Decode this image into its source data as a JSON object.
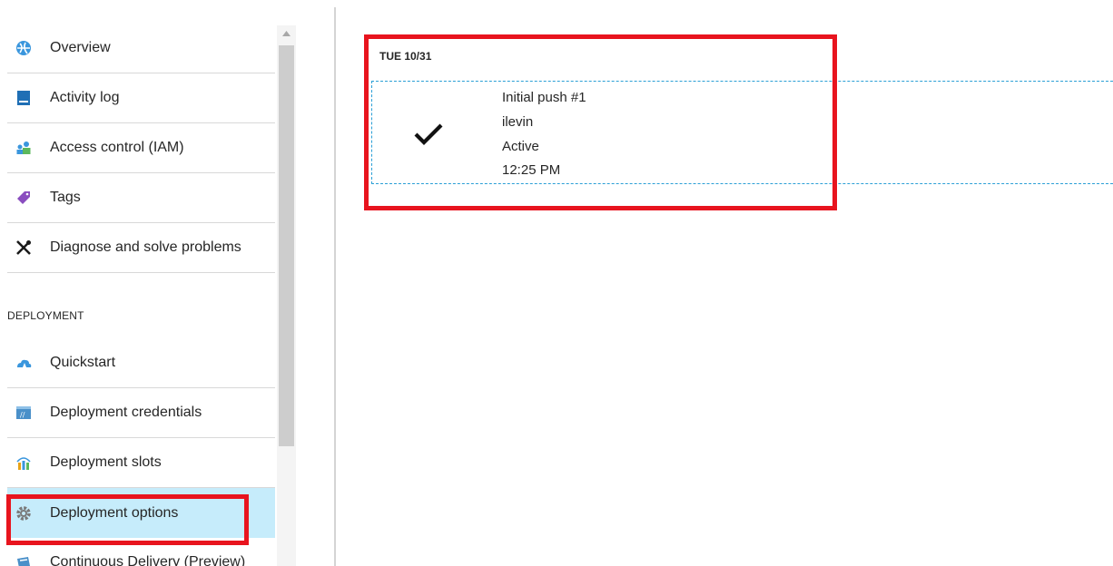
{
  "sidebar": {
    "items": [
      {
        "label": "Overview",
        "icon": "globe-icon"
      },
      {
        "label": "Activity log",
        "icon": "activity-log-icon"
      },
      {
        "label": "Access control (IAM)",
        "icon": "users-icon"
      },
      {
        "label": "Tags",
        "icon": "tag-icon"
      },
      {
        "label": "Diagnose and solve problems",
        "icon": "tools-icon"
      }
    ],
    "section_header": "DEPLOYMENT",
    "deployment_items": [
      {
        "label": "Quickstart",
        "icon": "cloud-icon"
      },
      {
        "label": "Deployment credentials",
        "icon": "credentials-icon"
      },
      {
        "label": "Deployment slots",
        "icon": "slots-icon"
      },
      {
        "label": "Deployment options",
        "icon": "gear-icon",
        "selected": true
      },
      {
        "label": "Continuous Delivery (Preview)",
        "icon": "delivery-icon"
      }
    ]
  },
  "main": {
    "date": "TUE 10/31",
    "deployment": {
      "title": "Initial push #1",
      "author": "ilevin",
      "status": "Active",
      "time": "12:25 PM",
      "status_icon": "checkmark-icon"
    }
  },
  "colors": {
    "highlight": "#e8141e",
    "selected_bg": "#c6ecfb",
    "dashed_border": "#2a9fd6"
  }
}
